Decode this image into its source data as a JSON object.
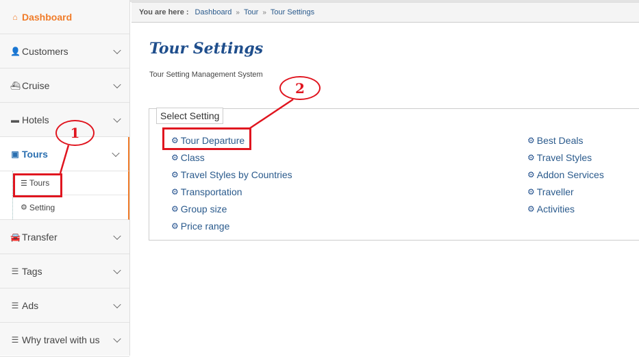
{
  "sidebar": {
    "items": [
      {
        "label": "Dashboard",
        "icon": "home-icon",
        "glyph": "⌂"
      },
      {
        "label": "Customers",
        "icon": "user-icon",
        "glyph": "👤"
      },
      {
        "label": "Cruise",
        "icon": "ship-icon",
        "glyph": "⛴"
      },
      {
        "label": "Hotels",
        "icon": "bed-icon",
        "glyph": "▬"
      },
      {
        "label": "Tours",
        "icon": "train-icon",
        "glyph": "▣"
      },
      {
        "label": "Transfer",
        "icon": "car-icon",
        "glyph": "🚘"
      },
      {
        "label": "Tags",
        "icon": "list-icon",
        "glyph": "☰"
      },
      {
        "label": "Ads",
        "icon": "list-ul-icon",
        "glyph": "☰"
      },
      {
        "label": "Why travel with us",
        "icon": "list-ul-icon",
        "glyph": "☰"
      }
    ],
    "tours_submenu": [
      {
        "label": "Tours",
        "icon": "list-ul-icon",
        "glyph": "☰"
      },
      {
        "label": "Setting",
        "icon": "gear-icon",
        "glyph": "⚙"
      }
    ]
  },
  "breadcrumb": {
    "label": "You are here :",
    "items": [
      "Dashboard",
      "Tour",
      "Tour Settings"
    ],
    "separator": "»"
  },
  "page": {
    "title": "Tour Settings",
    "subtitle": "Tour Setting Management System"
  },
  "settings": {
    "legend": "Select Setting",
    "gear_glyph": "⚙",
    "left": [
      "Tour Departure",
      "Class",
      "Travel Styles by Countries",
      "Transportation",
      "Group size",
      "Price range"
    ],
    "right": [
      "Best Deals",
      "Travel Styles",
      "Addon Services",
      "Traveller",
      "Activities"
    ]
  },
  "annotations": {
    "step1": "1",
    "step2": "2",
    "color": "#e0151f"
  }
}
